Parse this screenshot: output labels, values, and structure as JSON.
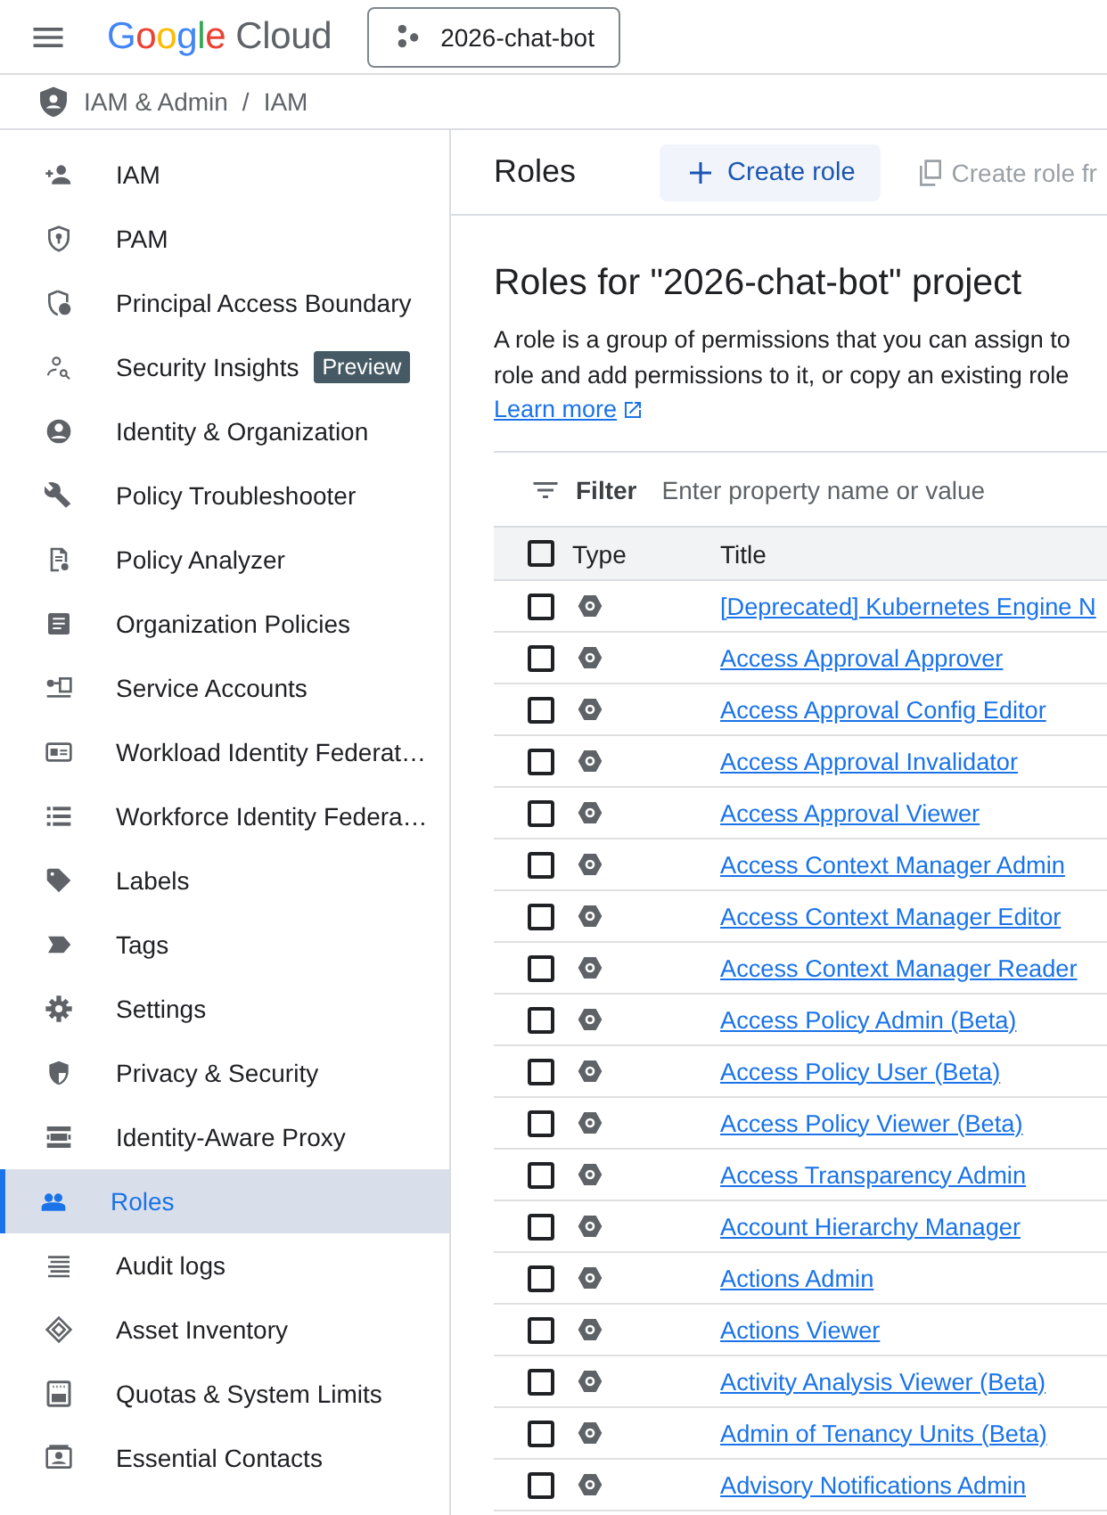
{
  "header": {
    "logo": "Google Cloud",
    "project": "2026-chat-bot"
  },
  "breadcrumb": {
    "items": [
      "IAM & Admin",
      "IAM"
    ],
    "separator": "/"
  },
  "sidebar": {
    "items": [
      {
        "label": "IAM",
        "selected": false
      },
      {
        "label": "PAM",
        "selected": false
      },
      {
        "label": "Principal Access Boundary",
        "selected": false
      },
      {
        "label": "Security Insights",
        "selected": false,
        "badge": "Preview"
      },
      {
        "label": "Identity & Organization",
        "selected": false
      },
      {
        "label": "Policy Troubleshooter",
        "selected": false
      },
      {
        "label": "Policy Analyzer",
        "selected": false
      },
      {
        "label": "Organization Policies",
        "selected": false
      },
      {
        "label": "Service Accounts",
        "selected": false
      },
      {
        "label": "Workload Identity Federat…",
        "selected": false
      },
      {
        "label": "Workforce Identity Federa…",
        "selected": false
      },
      {
        "label": "Labels",
        "selected": false
      },
      {
        "label": "Tags",
        "selected": false
      },
      {
        "label": "Settings",
        "selected": false
      },
      {
        "label": "Privacy & Security",
        "selected": false
      },
      {
        "label": "Identity-Aware Proxy",
        "selected": false
      },
      {
        "label": "Roles",
        "selected": true
      },
      {
        "label": "Audit logs",
        "selected": false
      },
      {
        "label": "Asset Inventory",
        "selected": false
      },
      {
        "label": "Quotas & System Limits",
        "selected": false
      },
      {
        "label": "Essential Contacts",
        "selected": false
      }
    ]
  },
  "toolbar": {
    "title": "Roles",
    "buttons": [
      {
        "label": "Create role",
        "disabled": false
      },
      {
        "label": "Create role fr",
        "disabled": true
      }
    ]
  },
  "content": {
    "heading": "Roles for \"2026-chat-bot\" project",
    "description": [
      "A role is a group of permissions that you can assign to",
      "role and add permissions to it, or copy an existing role"
    ],
    "link": "Learn more"
  },
  "filter": {
    "label": "Filter",
    "placeholder": "Enter property name or value"
  },
  "table": {
    "all_checked": false,
    "columns": [
      "Type",
      "Title"
    ],
    "rows": [
      {
        "title": "[Deprecated] Kubernetes Engine N",
        "checked": false
      },
      {
        "title": "Access Approval Approver",
        "checked": false
      },
      {
        "title": "Access Approval Config Editor",
        "checked": false
      },
      {
        "title": "Access Approval Invalidator",
        "checked": false
      },
      {
        "title": "Access Approval Viewer",
        "checked": false
      },
      {
        "title": "Access Context Manager Admin",
        "checked": false
      },
      {
        "title": "Access Context Manager Editor",
        "checked": false
      },
      {
        "title": "Access Context Manager Reader",
        "checked": false
      },
      {
        "title": "Access Policy Admin (Beta)",
        "checked": false
      },
      {
        "title": "Access Policy User (Beta)",
        "checked": false
      },
      {
        "title": "Access Policy Viewer (Beta)",
        "checked": false
      },
      {
        "title": "Access Transparency Admin",
        "checked": false
      },
      {
        "title": "Account Hierarchy Manager",
        "checked": false
      },
      {
        "title": "Actions Admin",
        "checked": false
      },
      {
        "title": "Actions Viewer",
        "checked": false
      },
      {
        "title": "Activity Analysis Viewer (Beta)",
        "checked": false
      },
      {
        "title": "Admin of Tenancy Units (Beta)",
        "checked": false
      },
      {
        "title": "Advisory Notifications Admin",
        "checked": false
      }
    ]
  }
}
